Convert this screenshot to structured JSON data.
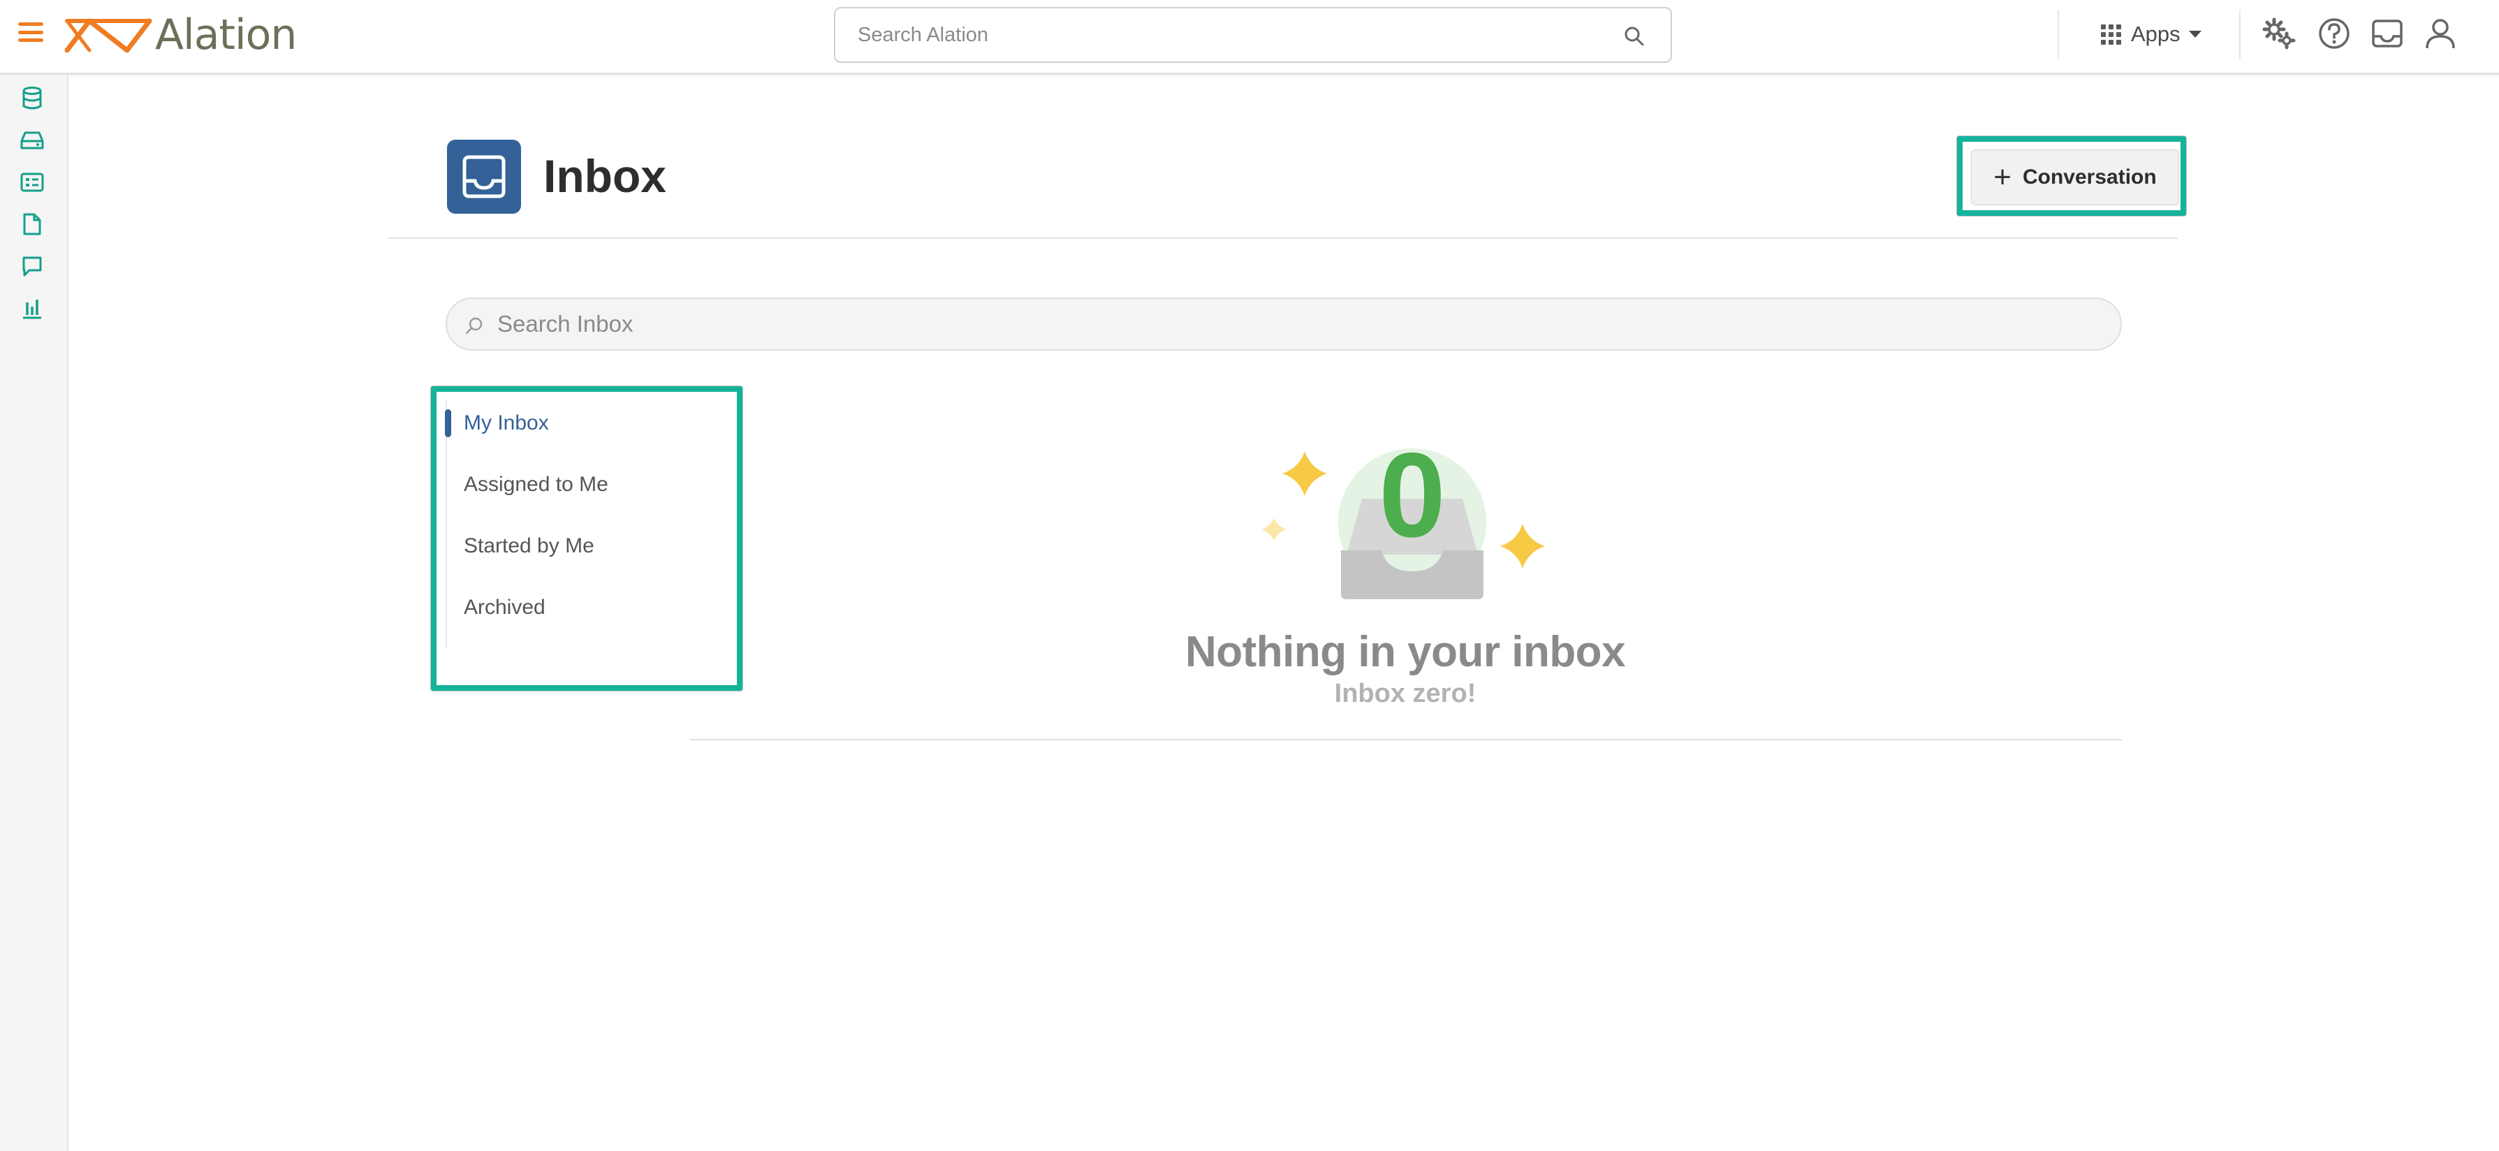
{
  "app": {
    "name": "Alation",
    "brand_color": "#f07c22",
    "accent_color": "#14b39a",
    "primary_color": "#336198"
  },
  "topbar": {
    "menu_icon": "hamburger-menu-icon",
    "search_placeholder": "Search Alation",
    "apps_label": "Apps",
    "icons": [
      "settings-gears-icon",
      "help-icon",
      "inbox-icon",
      "user-profile-icon"
    ]
  },
  "left_rail": {
    "items": [
      "database-icon",
      "storage-drive-icon",
      "catalog-card-icon",
      "document-icon",
      "chat-bubble-icon",
      "bar-chart-icon"
    ]
  },
  "page": {
    "title": "Inbox",
    "new_conversation_label": "Conversation",
    "search_placeholder": "Search Inbox"
  },
  "filters": {
    "items": [
      {
        "label": "My Inbox",
        "active": true
      },
      {
        "label": "Assigned to Me",
        "active": false
      },
      {
        "label": "Started by Me",
        "active": false
      },
      {
        "label": "Archived",
        "active": false
      }
    ]
  },
  "empty_state": {
    "count": "0",
    "title": "Nothing in your inbox",
    "subtitle": "Inbox zero!"
  }
}
